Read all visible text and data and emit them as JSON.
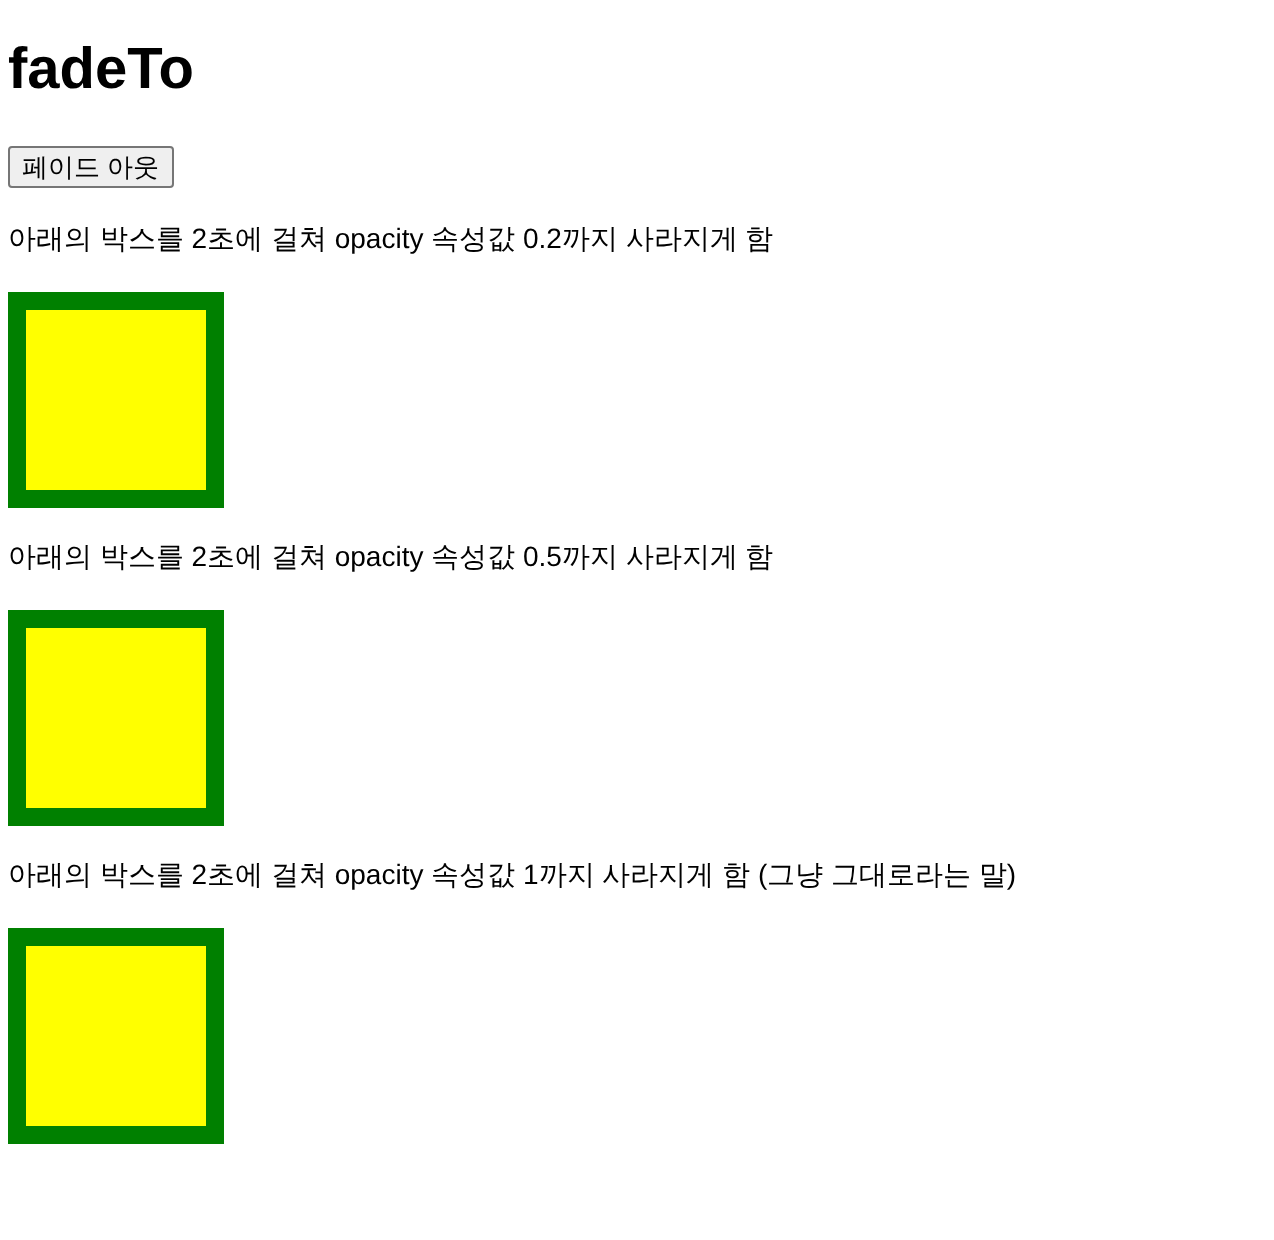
{
  "title": "fadeTo",
  "button": {
    "label": "페이드 아웃"
  },
  "sections": [
    {
      "caption": "아래의 박스를 2초에 걸쳐 opacity 속성값 0.2까지 사라지게 함"
    },
    {
      "caption": "아래의 박스를 2초에 걸쳐 opacity 속성값 0.5까지 사라지게 함"
    },
    {
      "caption": "아래의 박스를 2초에 걸쳐 opacity 속성값 1까지 사라지게 함 (그냥 그대로라는 말)"
    }
  ]
}
